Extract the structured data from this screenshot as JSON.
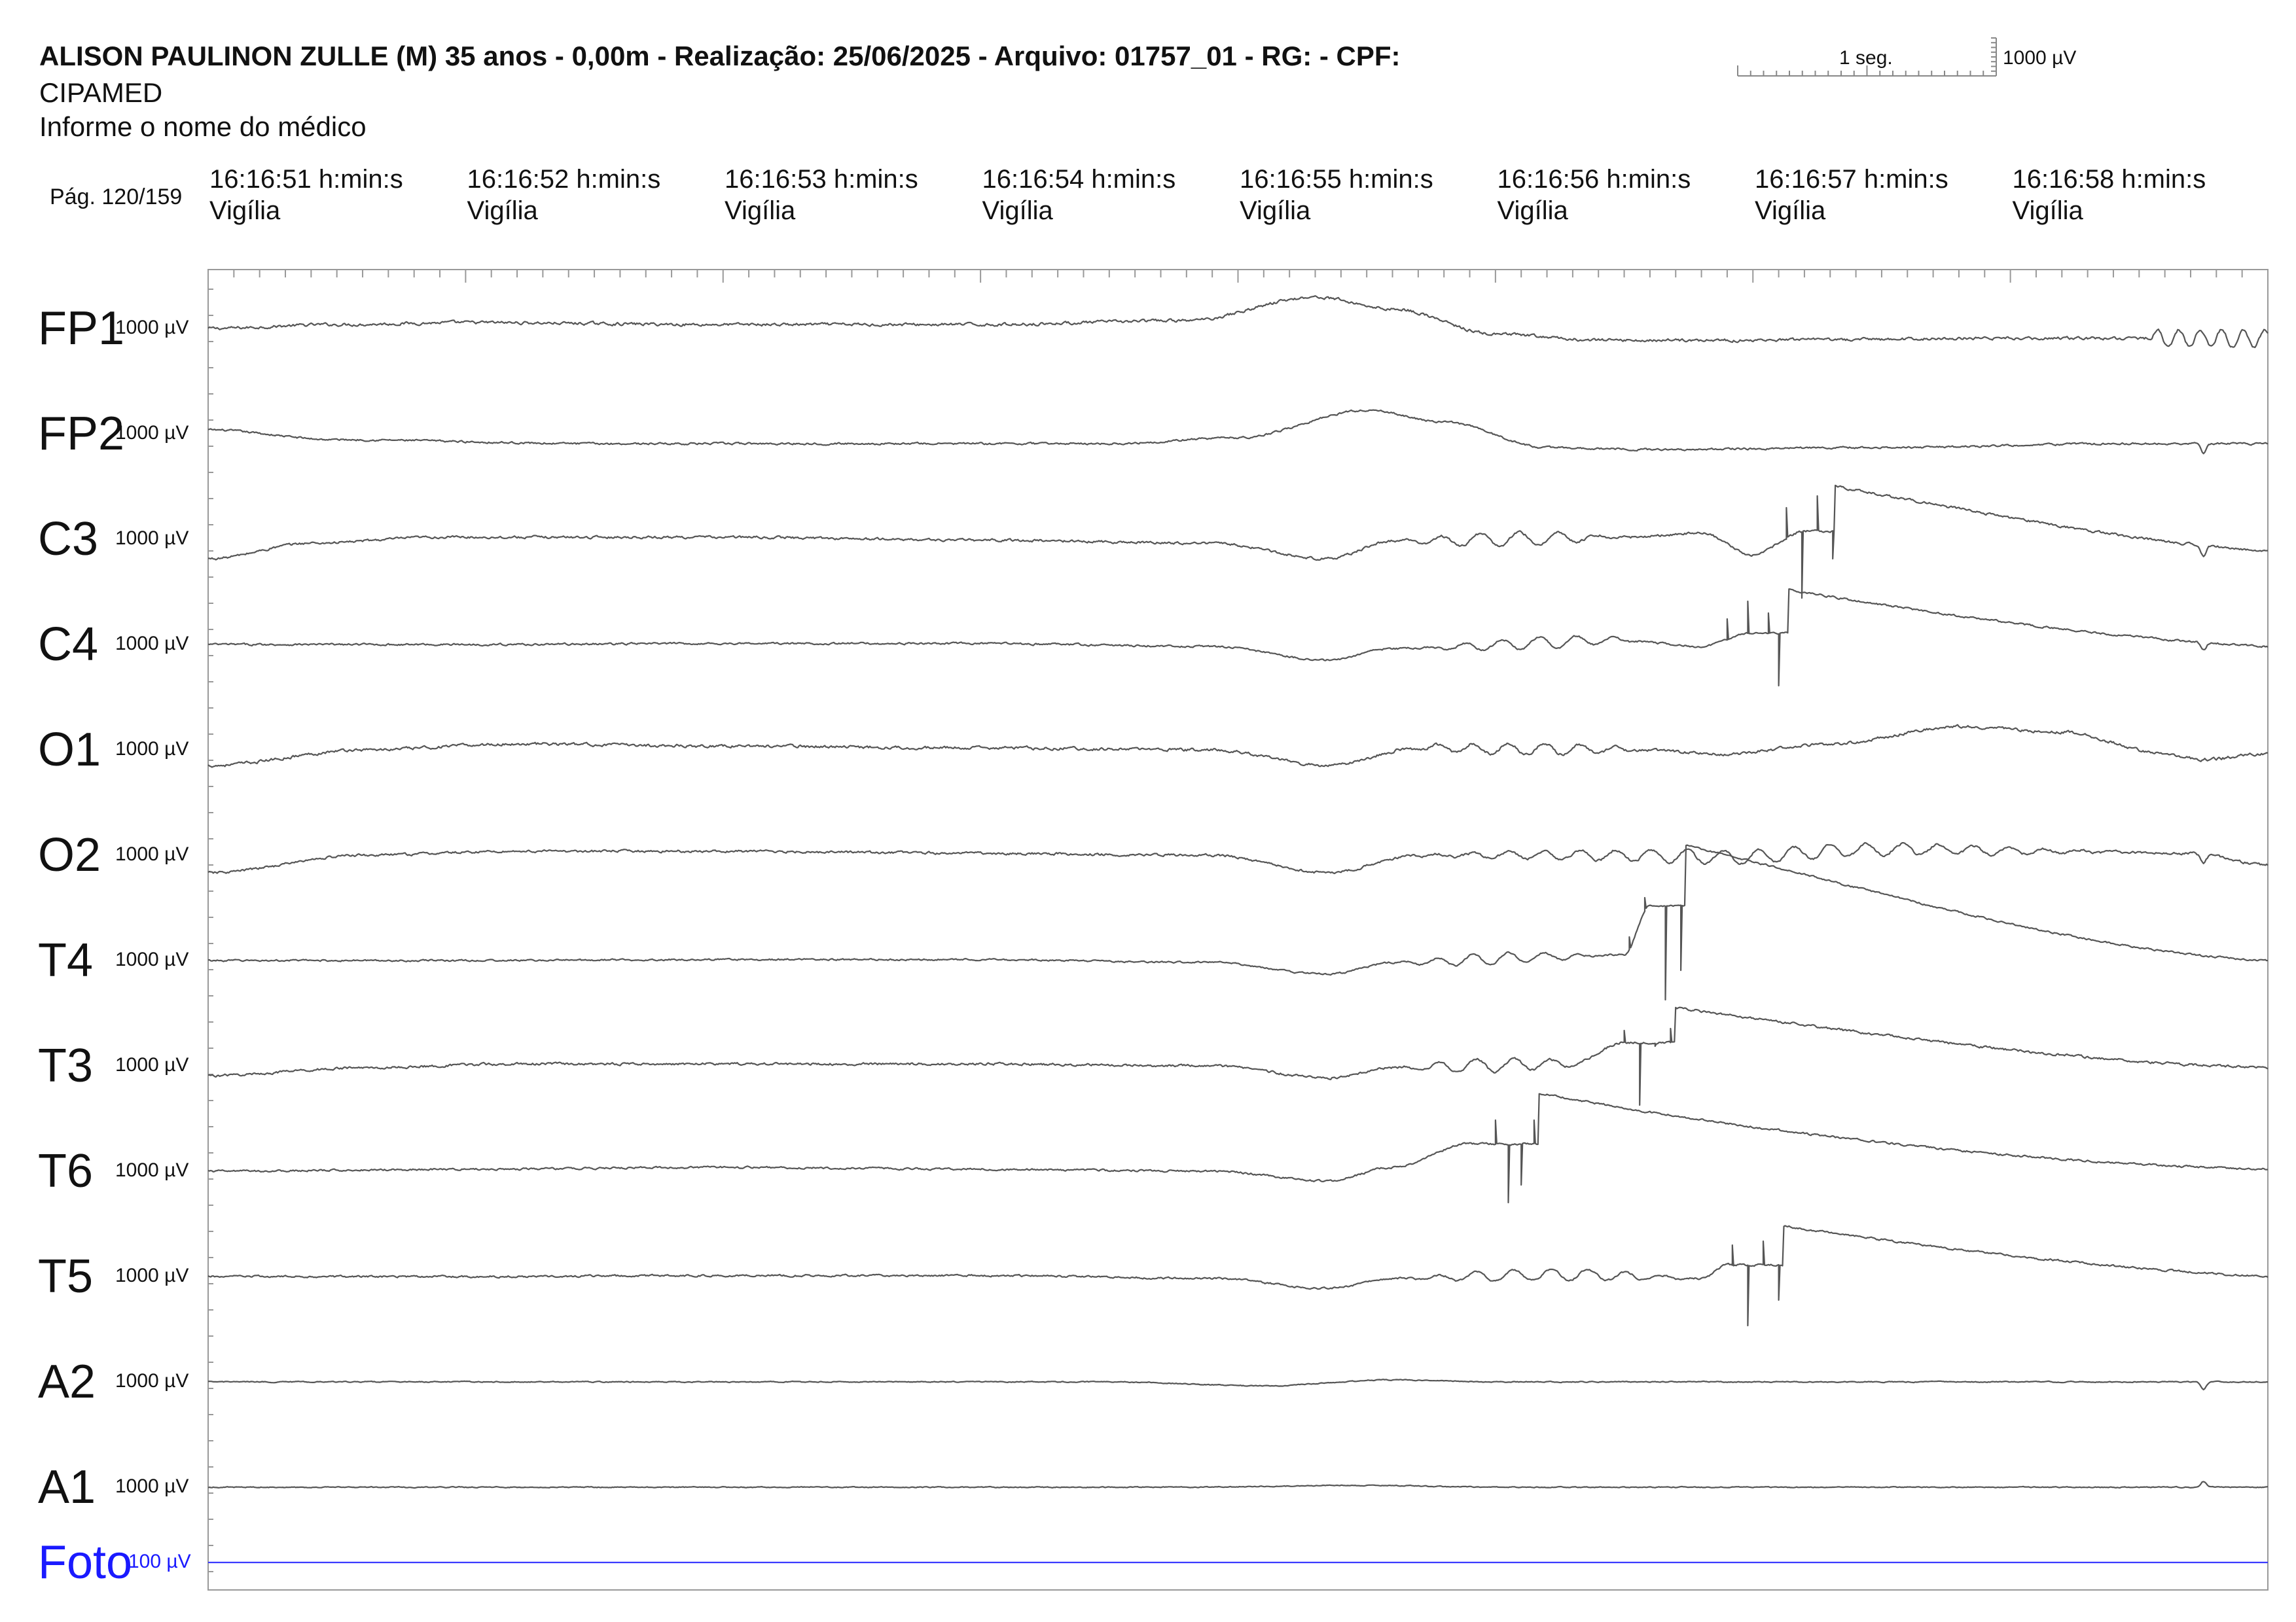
{
  "header": {
    "title": "ALISON PAULINON ZULLE (M) 35 anos - 0,00m - Realização: 25/06/2025 - Arquivo: 01757_01 - RG:  - CPF:",
    "clinic": "CIPAMED",
    "doctor": "Informe o nome do médico",
    "page": "Pág. 120/159"
  },
  "scale": {
    "time_label": "1 seg.",
    "amplitude_label": "1000 µV"
  },
  "time_marks": [
    {
      "time": "16:16:51 h:min:s",
      "state": "Vigília"
    },
    {
      "time": "16:16:52 h:min:s",
      "state": "Vigília"
    },
    {
      "time": "16:16:53 h:min:s",
      "state": "Vigília"
    },
    {
      "time": "16:16:54 h:min:s",
      "state": "Vigília"
    },
    {
      "time": "16:16:55 h:min:s",
      "state": "Vigília"
    },
    {
      "time": "16:16:56 h:min:s",
      "state": "Vigília"
    },
    {
      "time": "16:16:57 h:min:s",
      "state": "Vigília"
    },
    {
      "time": "16:16:58 h:min:s",
      "state": "Vigília"
    }
  ],
  "colors": {
    "trace": "#555555",
    "photic": "#3b3bff",
    "photic_label": "#1a1aff",
    "frame": "#999999"
  },
  "chart_data": {
    "type": "line",
    "x_unit": "s",
    "xlim": [
      0,
      8
    ],
    "channels": [
      {
        "name": "FP1",
        "sensitivity": "1000 µV",
        "color": "trace",
        "knots": [
          [
            0,
            0
          ],
          [
            0.5,
            0.2
          ],
          [
            1,
            0.3
          ],
          [
            2,
            0.2
          ],
          [
            3,
            0.2
          ],
          [
            3.8,
            0.4
          ],
          [
            4.3,
            1.6
          ],
          [
            4.6,
            1.0
          ],
          [
            5,
            -0.3
          ],
          [
            5.4,
            -0.6
          ],
          [
            6,
            -0.6
          ],
          [
            7,
            -0.5
          ],
          [
            7.6,
            -0.5
          ],
          [
            8,
            -0.5
          ]
        ],
        "noise": 0.12,
        "high_freq": [
          [
            7.55,
            8.0,
            0.45,
            12
          ]
        ]
      },
      {
        "name": "FP2",
        "sensitivity": "1000 µV",
        "color": "trace",
        "knots": [
          [
            0,
            0.2
          ],
          [
            0.5,
            -0.3
          ],
          [
            1.5,
            -0.5
          ],
          [
            2.5,
            -0.5
          ],
          [
            3.5,
            -0.5
          ],
          [
            4.0,
            -0.2
          ],
          [
            4.5,
            1.2
          ],
          [
            4.8,
            0.6
          ],
          [
            5.2,
            -0.7
          ],
          [
            5.6,
            -0.8
          ],
          [
            6.5,
            -0.7
          ],
          [
            7.5,
            -0.5
          ],
          [
            8,
            -0.5
          ]
        ],
        "noise": 0.08,
        "notches": [
          [
            7.75,
            -0.5
          ]
        ]
      },
      {
        "name": "C3",
        "sensitivity": "1000 µV",
        "color": "trace",
        "knots": [
          [
            0,
            -1.0
          ],
          [
            0.4,
            -0.2
          ],
          [
            0.9,
            0.1
          ],
          [
            2,
            0.1
          ],
          [
            3,
            -0.05
          ],
          [
            3.9,
            -0.2
          ],
          [
            4.35,
            -1.0
          ],
          [
            4.6,
            -0.1
          ],
          [
            5.5,
            0.1
          ],
          [
            5.8,
            0.3
          ],
          [
            6.0,
            -0.8
          ],
          [
            6.2,
            0.4
          ],
          [
            8,
            -0.6
          ]
        ],
        "noise": 0.1,
        "osc": [
          [
            4.6,
            5.5,
            0.35,
            2.2
          ]
        ],
        "spikes": [
          [
            6.13,
            1.6
          ],
          [
            6.19,
            -3.0
          ],
          [
            6.25,
            2.2
          ],
          [
            6.31,
            -1.0
          ]
        ],
        "decay": [
          6.32,
          2.3,
          1.3
        ],
        "notches": [
          [
            7.75,
            -0.5
          ]
        ]
      },
      {
        "name": "C4",
        "sensitivity": "1000 µV",
        "color": "trace",
        "knots": [
          [
            0,
            0
          ],
          [
            1,
            0
          ],
          [
            2,
            0.05
          ],
          [
            3,
            0.05
          ],
          [
            3.9,
            -0.1
          ],
          [
            4.35,
            -0.8
          ],
          [
            4.6,
            -0.2
          ],
          [
            5.5,
            0.2
          ],
          [
            5.8,
            -0.1
          ],
          [
            6.0,
            0.6
          ],
          [
            8,
            -0.1
          ]
        ],
        "noise": 0.08,
        "osc": [
          [
            4.7,
            5.6,
            0.3,
            2.3
          ]
        ],
        "spikes": [
          [
            5.9,
            1.3
          ],
          [
            5.98,
            2.2
          ],
          [
            6.06,
            1.6
          ],
          [
            6.1,
            -2.1
          ]
        ],
        "decay": [
          6.14,
          2.2,
          1.2
        ],
        "notches": [
          [
            7.75,
            -0.4
          ]
        ]
      },
      {
        "name": "O1",
        "sensitivity": "1000 µV",
        "color": "trace",
        "knots": [
          [
            0,
            -0.8
          ],
          [
            0.6,
            0
          ],
          [
            1.2,
            0.3
          ],
          [
            2,
            0.2
          ],
          [
            3,
            0.1
          ],
          [
            3.9,
            0
          ],
          [
            4.35,
            -0.8
          ],
          [
            4.7,
            0.1
          ],
          [
            5.5,
            0
          ],
          [
            5.9,
            -0.2
          ],
          [
            6.3,
            0.3
          ],
          [
            6.8,
            1.2
          ],
          [
            7.2,
            0.9
          ],
          [
            7.6,
            -0.2
          ],
          [
            7.75,
            -0.5
          ],
          [
            8,
            -0.2
          ]
        ],
        "noise": 0.12,
        "osc": [
          [
            4.6,
            5.6,
            0.3,
            2.4
          ]
        ]
      },
      {
        "name": "O2",
        "sensitivity": "1000 µV",
        "color": "trace",
        "knots": [
          [
            0,
            -0.9
          ],
          [
            0.6,
            0
          ],
          [
            1.2,
            0.2
          ],
          [
            2,
            0.2
          ],
          [
            3,
            0.1
          ],
          [
            3.9,
            0
          ],
          [
            4.35,
            -0.9
          ],
          [
            4.7,
            0
          ],
          [
            5.5,
            0
          ],
          [
            5.9,
            -0.1
          ],
          [
            6.5,
            0.3
          ],
          [
            7.2,
            0.2
          ],
          [
            7.7,
            0.1
          ],
          [
            8,
            -0.5
          ]
        ],
        "noise": 0.1,
        "osc": [
          [
            4.6,
            7.5,
            0.35,
            2.4
          ]
        ],
        "notches": [
          [
            7.75,
            -0.5
          ]
        ]
      },
      {
        "name": "T4",
        "sensitivity": "1000 µV",
        "color": "trace",
        "knots": [
          [
            0,
            0
          ],
          [
            1,
            0
          ],
          [
            2,
            0.05
          ],
          [
            3,
            0.05
          ],
          [
            3.9,
            -0.1
          ],
          [
            4.35,
            -0.7
          ],
          [
            4.6,
            -0.1
          ],
          [
            5.3,
            0.2
          ],
          [
            5.5,
            0.3
          ],
          [
            5.6,
            2.8
          ],
          [
            8,
            0
          ]
        ],
        "noise": 0.07,
        "osc": [
          [
            4.6,
            5.4,
            0.3,
            2.4
          ]
        ],
        "spikes": [
          [
            5.52,
            1.2
          ],
          [
            5.58,
            3.2
          ],
          [
            5.66,
            -2.0
          ],
          [
            5.72,
            -0.5
          ]
        ],
        "decay": [
          5.74,
          3.1,
          1.2
        ]
      },
      {
        "name": "T3",
        "sensitivity": "1000 µV",
        "color": "trace",
        "knots": [
          [
            0,
            -0.5
          ],
          [
            0.6,
            -0.1
          ],
          [
            1.2,
            0.1
          ],
          [
            2,
            0.1
          ],
          [
            3,
            0.1
          ],
          [
            3.9,
            0
          ],
          [
            4.35,
            -0.6
          ],
          [
            4.6,
            -0.1
          ],
          [
            5.3,
            0.1
          ],
          [
            5.5,
            1.2
          ],
          [
            8,
            -0.1
          ]
        ],
        "noise": 0.1,
        "osc": [
          [
            4.6,
            5.4,
            0.35,
            2.3
          ]
        ],
        "spikes": [
          [
            5.5,
            1.8
          ],
          [
            5.56,
            -2.0
          ],
          [
            5.62,
            1.0
          ],
          [
            5.68,
            1.9
          ]
        ],
        "decay": [
          5.7,
          1.8,
          1.2
        ]
      },
      {
        "name": "T6",
        "sensitivity": "1000 µV",
        "color": "trace",
        "knots": [
          [
            0,
            0
          ],
          [
            1,
            0.1
          ],
          [
            2,
            0.2
          ],
          [
            3,
            0.1
          ],
          [
            3.9,
            0
          ],
          [
            4.35,
            -0.5
          ],
          [
            4.6,
            0.2
          ],
          [
            4.9,
            1.4
          ],
          [
            8,
            0.1
          ]
        ],
        "noise": 0.08,
        "spikes": [
          [
            5.0,
            2.6
          ],
          [
            5.05,
            -1.6
          ],
          [
            5.1,
            -0.7
          ],
          [
            5.15,
            2.6
          ]
        ],
        "decay": [
          5.17,
          2.6,
          1.2
        ]
      },
      {
        "name": "T5",
        "sensitivity": "1000 µV",
        "color": "trace",
        "knots": [
          [
            0,
            0
          ],
          [
            1,
            0
          ],
          [
            2,
            0.05
          ],
          [
            3,
            0.05
          ],
          [
            3.9,
            -0.1
          ],
          [
            4.35,
            -0.6
          ],
          [
            4.6,
            -0.1
          ],
          [
            5.3,
            0.1
          ],
          [
            5.8,
            -0.1
          ],
          [
            5.9,
            0.6
          ],
          [
            8,
            0
          ]
        ],
        "noise": 0.08,
        "osc": [
          [
            4.6,
            5.8,
            0.3,
            2.3
          ]
        ],
        "spikes": [
          [
            5.92,
            1.6
          ],
          [
            5.98,
            -2.5
          ],
          [
            6.04,
            1.8
          ],
          [
            6.1,
            -1.2
          ]
        ],
        "decay": [
          6.12,
          2.0,
          1.3
        ]
      },
      {
        "name": "A2",
        "sensitivity": "1000 µV",
        "color": "trace",
        "knots": [
          [
            0,
            0
          ],
          [
            3.5,
            0
          ],
          [
            4.1,
            -0.2
          ],
          [
            4.6,
            0.1
          ],
          [
            5,
            0
          ],
          [
            8,
            0
          ]
        ],
        "noise": 0.04,
        "notches": [
          [
            7.75,
            -0.4
          ]
        ]
      },
      {
        "name": "A1",
        "sensitivity": "1000 µV",
        "color": "trace",
        "knots": [
          [
            0,
            0
          ],
          [
            3.8,
            0
          ],
          [
            4.5,
            0.1
          ],
          [
            5,
            0
          ],
          [
            8,
            0
          ]
        ],
        "noise": 0.04,
        "notches": [
          [
            7.75,
            0.3
          ]
        ]
      },
      {
        "name": "Foto",
        "sensitivity": "100 µV",
        "color": "photic",
        "knots": [
          [
            0,
            0
          ],
          [
            8,
            0
          ]
        ],
        "noise": 0
      }
    ]
  }
}
